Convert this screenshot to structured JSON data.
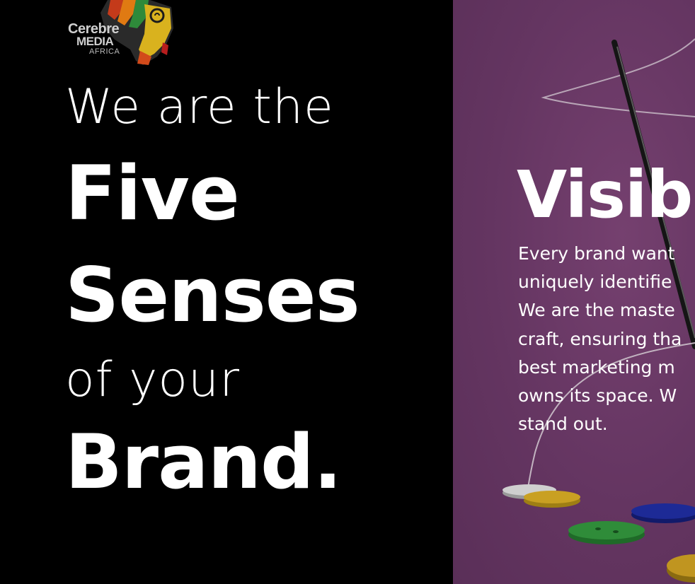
{
  "logo": {
    "line1": "Cerebre",
    "line2": "MEDIA",
    "line3": "AFRICA"
  },
  "hero": {
    "line1": "We are the",
    "line2": "Five",
    "line3": "Senses",
    "line4": "of your",
    "line5": "Brand."
  },
  "panel": {
    "heading": "Visib",
    "paragraph_lines": [
      "Every brand want",
      "uniquely identifie",
      "We are the maste",
      "craft, ensuring tha",
      "best marketing m",
      "owns its space. W",
      "stand out."
    ]
  },
  "colors": {
    "left_bg": "#000000",
    "panel_bg": "#643561",
    "text": "#ffffff"
  }
}
